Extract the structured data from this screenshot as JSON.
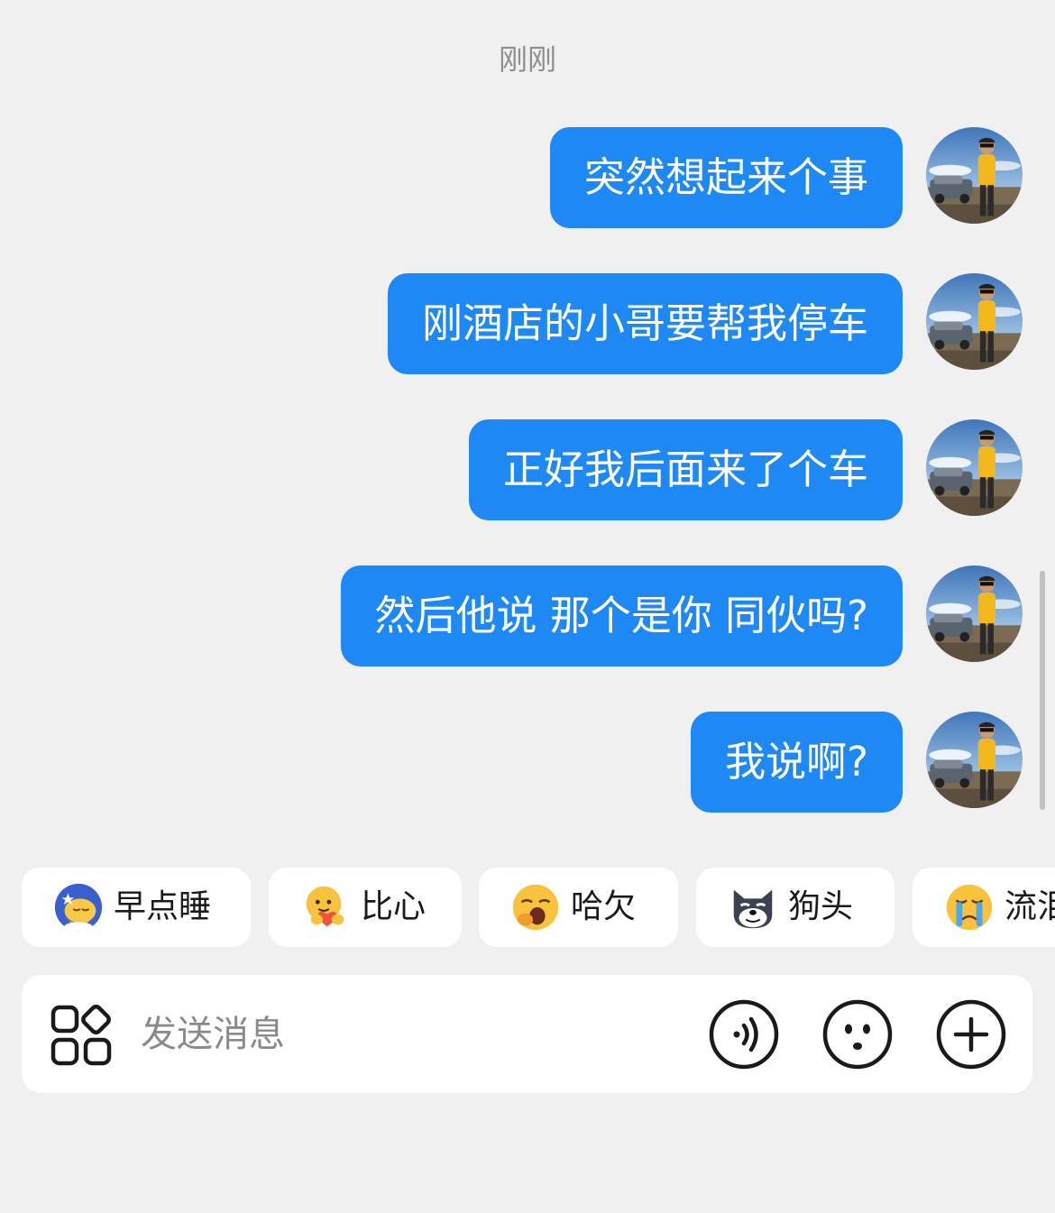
{
  "chat": {
    "timestamp": "刚刚",
    "messages": [
      {
        "text": "突然想起来个事"
      },
      {
        "text": "刚酒店的小哥要帮我停车"
      },
      {
        "text": "正好我后面来了个车"
      },
      {
        "text": "然后他说 那个是你 同伙吗?"
      },
      {
        "text": "我说啊?"
      }
    ]
  },
  "quick_replies": [
    {
      "label": "早点睡",
      "icon": "sleepy-moon-emoji"
    },
    {
      "label": "比心",
      "icon": "heart-hands-emoji"
    },
    {
      "label": "哈欠",
      "icon": "yawn-emoji"
    },
    {
      "label": "狗头",
      "icon": "doge-emoji"
    },
    {
      "label": "流泪",
      "icon": "crying-emoji"
    }
  ],
  "composer": {
    "placeholder": "发送消息",
    "value": ""
  },
  "colors": {
    "background": "#f0f0f0",
    "bubble": "#1e88f5",
    "bubble_text": "#ffffff",
    "chip_bg": "#ffffff",
    "icon_stroke": "#1a1a1a"
  }
}
